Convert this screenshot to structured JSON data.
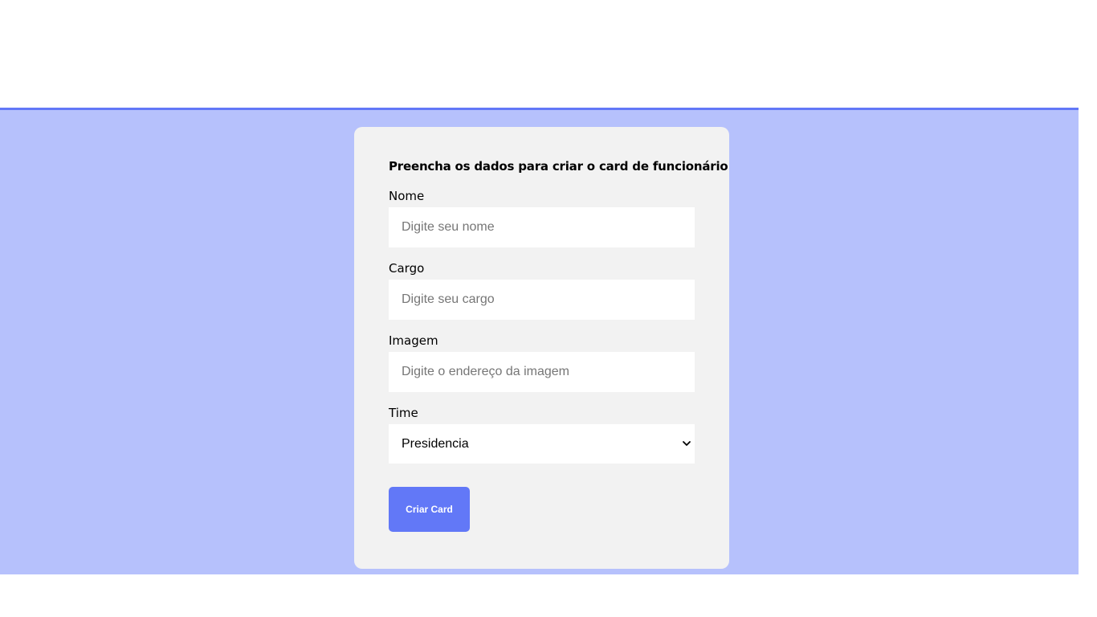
{
  "form": {
    "title": "Preencha os dados para criar o card de funcionário",
    "fields": [
      {
        "label": "Nome",
        "placeholder": "Digite seu nome",
        "value": ""
      },
      {
        "label": "Cargo",
        "placeholder": "Digite seu cargo",
        "value": ""
      },
      {
        "label": "Imagem",
        "placeholder": "Digite o endereço da imagem",
        "value": ""
      }
    ],
    "team": {
      "label": "Time",
      "selected": "Presidencia"
    },
    "submit_label": "Criar Card"
  },
  "colors": {
    "banner_background": "#b6c1fc",
    "banner_border": "#6278f7",
    "card_background": "#f2f2f2",
    "button_background": "#6278f7"
  }
}
